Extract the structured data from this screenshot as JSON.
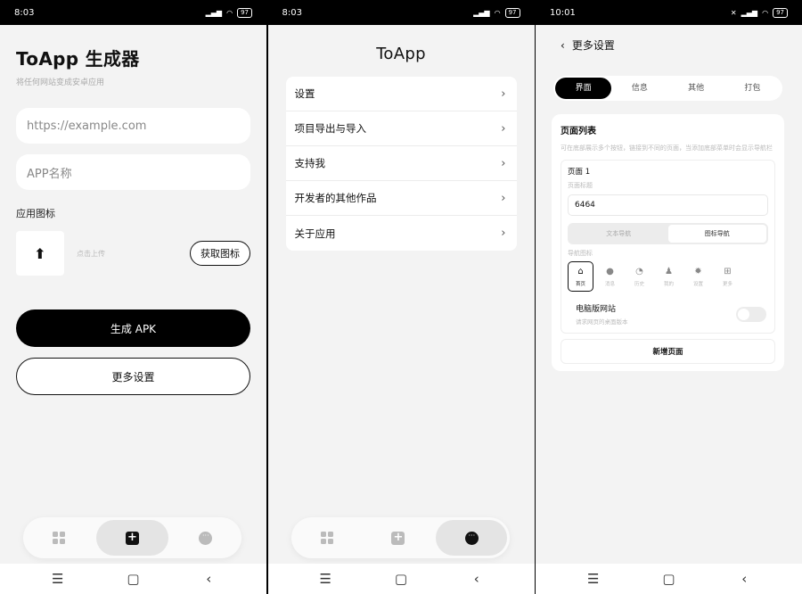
{
  "screen1": {
    "status_time": "8:03",
    "battery": "97",
    "title": "ToApp 生成器",
    "subtitle": "将任何网站变成安卓应用",
    "url_placeholder": "https://example.com",
    "name_placeholder": "APP名称",
    "icon_label": "应用图标",
    "upload_hint": "点击上传",
    "fetch_icon": "获取图标",
    "generate": "生成 APK",
    "more_settings": "更多设置"
  },
  "screen2": {
    "status_time": "8:03",
    "battery": "97",
    "title": "ToApp",
    "menu": [
      {
        "label": "设置"
      },
      {
        "label": "项目导出与导入"
      },
      {
        "label": "支持我"
      },
      {
        "label": "开发者的其他作品"
      },
      {
        "label": "关于应用"
      }
    ]
  },
  "screen3": {
    "status_time": "10:01",
    "battery": "97",
    "title": "更多设置",
    "tabs": [
      "界面",
      "信息",
      "其他",
      "打包"
    ],
    "active_tab": "界面",
    "card_title": "页面列表",
    "card_desc": "可在底部展示多个按钮，链接到不同的页面，当添加底部菜单时会显示导航栏",
    "page_title": "页面 1",
    "page_title_label": "页面标题",
    "page_title_value": "6464",
    "mode_options": [
      "文本导航",
      "图标导航"
    ],
    "mode_active": "图标导航",
    "icon_label": "导航图标",
    "icons": [
      {
        "glyph": "⌂",
        "name": "home-icon",
        "label": "首页"
      },
      {
        "glyph": "●",
        "name": "circle-icon",
        "label": "消息"
      },
      {
        "glyph": "◔",
        "name": "clock-icon",
        "label": "历史"
      },
      {
        "glyph": "♟",
        "name": "user-icon",
        "label": "我的"
      },
      {
        "glyph": "✹",
        "name": "gear-icon",
        "label": "设置"
      },
      {
        "glyph": "⊞",
        "name": "plus-icon",
        "label": "更多"
      }
    ],
    "selected_icon": "首页",
    "desktop_label": "电脑版网站",
    "desktop_desc": "请求网页的桌面版本",
    "desktop_enabled": false,
    "add_page": "新增页面"
  }
}
